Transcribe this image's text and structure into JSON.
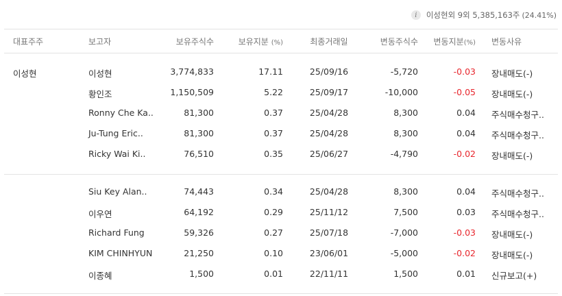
{
  "summary": {
    "info_icon": "i",
    "text": "이성현외 9외 5,385,163주",
    "pct": "(24.41%)"
  },
  "header": {
    "rep": "대표주주",
    "reporter": "보고자",
    "shares": "보유주식수",
    "ratio": "보유지분",
    "ratio_unit": "(%)",
    "last_date": "최종거래일",
    "change_shares": "변동주식수",
    "change_ratio": "변동지분",
    "change_ratio_unit": "(%)",
    "reason": "변동사유"
  },
  "colors": {
    "negative": "#e8262d",
    "text": "#333333",
    "header": "#777777",
    "divider": "#e3e3e3"
  },
  "groups": [
    {
      "rep": "이성현",
      "rows": [
        {
          "name": "이성현",
          "shares": "3,774,833",
          "ratio": "17.11",
          "date": "25/09/16",
          "chg": "-5,720",
          "chg_ratio": "-0.03",
          "reason": "장내매도(-)"
        },
        {
          "name": "황인조",
          "shares": "1,150,509",
          "ratio": "5.22",
          "date": "25/09/17",
          "chg": "-10,000",
          "chg_ratio": "-0.05",
          "reason": "장내매도(-)"
        },
        {
          "name": "Ronny Che Ka..",
          "shares": "81,300",
          "ratio": "0.37",
          "date": "25/04/28",
          "chg": "8,300",
          "chg_ratio": "0.04",
          "reason": "주식매수청구.."
        },
        {
          "name": "Ju-Tung Eric..",
          "shares": "81,300",
          "ratio": "0.37",
          "date": "25/04/28",
          "chg": "8,300",
          "chg_ratio": "0.04",
          "reason": "주식매수청구.."
        },
        {
          "name": "Ricky Wai Ki..",
          "shares": "76,510",
          "ratio": "0.35",
          "date": "25/06/27",
          "chg": "-4,790",
          "chg_ratio": "-0.02",
          "reason": "장내매도(-)"
        }
      ]
    },
    {
      "rep": "",
      "rows": [
        {
          "name": "Siu Key Alan..",
          "shares": "74,443",
          "ratio": "0.34",
          "date": "25/04/28",
          "chg": "8,300",
          "chg_ratio": "0.04",
          "reason": "주식매수청구.."
        },
        {
          "name": "이우연",
          "shares": "64,192",
          "ratio": "0.29",
          "date": "25/11/12",
          "chg": "7,500",
          "chg_ratio": "0.03",
          "reason": "주식매수청구.."
        },
        {
          "name": "Richard Fung",
          "shares": "59,326",
          "ratio": "0.27",
          "date": "25/07/18",
          "chg": "-7,000",
          "chg_ratio": "-0.03",
          "reason": "장내매도(-)"
        },
        {
          "name": "KIM CHINHYUN",
          "shares": "21,250",
          "ratio": "0.10",
          "date": "23/06/01",
          "chg": "-5,000",
          "chg_ratio": "-0.02",
          "reason": "장내매도(-)"
        },
        {
          "name": "이종혜",
          "shares": "1,500",
          "ratio": "0.01",
          "date": "22/11/11",
          "chg": "1,500",
          "chg_ratio": "0.01",
          "reason": "신규보고(+)"
        }
      ]
    }
  ]
}
